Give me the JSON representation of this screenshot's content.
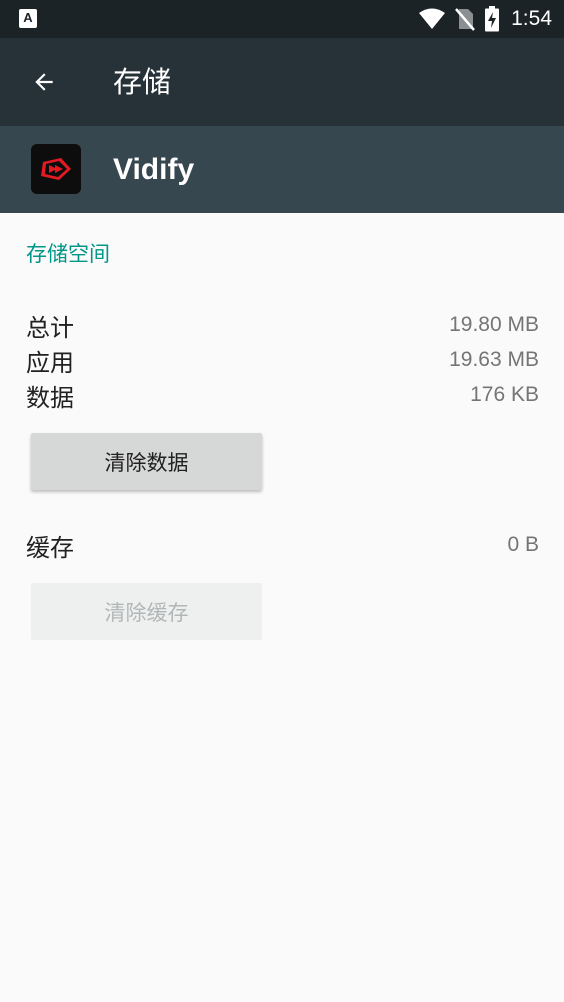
{
  "status_bar": {
    "indicator": "A",
    "time": "1:54",
    "icons": [
      "wifi-icon",
      "no-sim-icon",
      "battery-charging-icon"
    ]
  },
  "toolbar": {
    "back_icon": "arrow-back-icon",
    "title": "存储"
  },
  "app": {
    "name": "Vidify",
    "icon": "vidify-app-icon",
    "icon_colors": {
      "background": "#0d0d0d",
      "accent": "#e21b23"
    }
  },
  "storage": {
    "section_title": "存储空间",
    "rows": [
      {
        "label": "总计",
        "value": "19.80 MB"
      },
      {
        "label": "应用",
        "value": "19.63 MB"
      },
      {
        "label": "数据",
        "value": "176 KB"
      }
    ],
    "clear_data_label": "清除数据"
  },
  "cache": {
    "label": "缓存",
    "value": "0 B",
    "clear_cache_label": "清除缓存",
    "clear_cache_enabled": false
  },
  "colors": {
    "status_bar": "#1c2327",
    "toolbar": "#263238",
    "app_header": "#37474f",
    "accent": "#009688",
    "background": "#fafafa"
  }
}
